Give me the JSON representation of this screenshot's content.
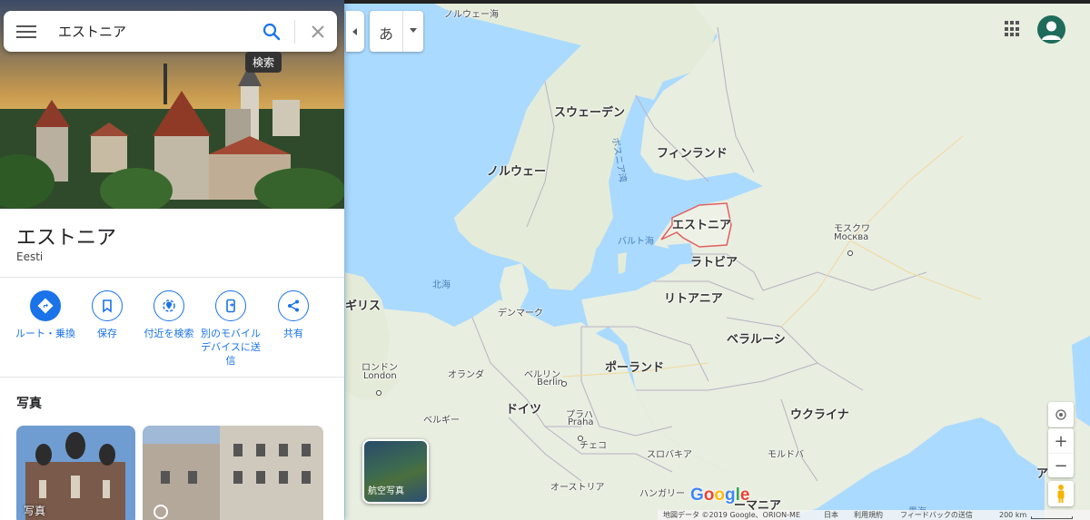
{
  "search": {
    "query": "エストニア",
    "tooltip": "検索"
  },
  "place": {
    "title": "エストニア",
    "subtitle": "Eesti",
    "actions": [
      {
        "label": "ルート・乗換",
        "icon": "directions-icon"
      },
      {
        "label": "保存",
        "icon": "bookmark-icon"
      },
      {
        "label": "付近を検索",
        "icon": "nearby-icon"
      },
      {
        "label": "別のモバイルデバイスに送信",
        "icon": "send-to-device-icon"
      },
      {
        "label": "共有",
        "icon": "share-icon"
      }
    ],
    "photos_title": "写真",
    "photos": [
      {
        "label": "写真"
      },
      {
        "label": ""
      }
    ]
  },
  "toolbar": {
    "input_tool_label": "あ"
  },
  "map": {
    "satellite_label": "航空写真",
    "labels": {
      "norwegian_sea": "ノルウェー海",
      "sweden": "スウェーデン",
      "finland": "フィンランド",
      "norway": "ノルウェー",
      "bothnia": "ボスニア湾",
      "estonia": "エストニア",
      "baltic_sea": "バルト海",
      "moscow_ja": "モスクワ",
      "moscow": "Москва",
      "latvia": "ラトビア",
      "north_sea": "北海",
      "uk": "ギリス",
      "denmark": "デンマーク",
      "lithuania": "リトアニア",
      "belarus": "ベラルーシ",
      "london_ja": "ロンドン",
      "london": "London",
      "netherlands": "オランダ",
      "berlin_ja": "ベルリン",
      "berlin": "Berlin",
      "poland": "ポーランド",
      "belgium": "ベルギー",
      "germany": "ドイツ",
      "prague_ja": "プラハ",
      "prague": "Praha",
      "czech": "チェコ",
      "ukraine": "ウクライナ",
      "slovakia": "スロバキア",
      "moldova": "モルドバ",
      "austria": "オーストリア",
      "hungary": "ハンガリー",
      "romania": "ーマニア",
      "black_sea": "黒海",
      "edge_right": "ア"
    }
  },
  "footer": {
    "map_data": "地図データ ©2019 Google、ORION-ME",
    "country": "日本",
    "terms": "利用規約",
    "feedback": "フィードバックの送信",
    "scale": "200 km"
  },
  "colors": {
    "accent": "#1a73e8",
    "water": "#aadaff",
    "land": "#e8eee0",
    "highlight_border": "#e06060"
  }
}
